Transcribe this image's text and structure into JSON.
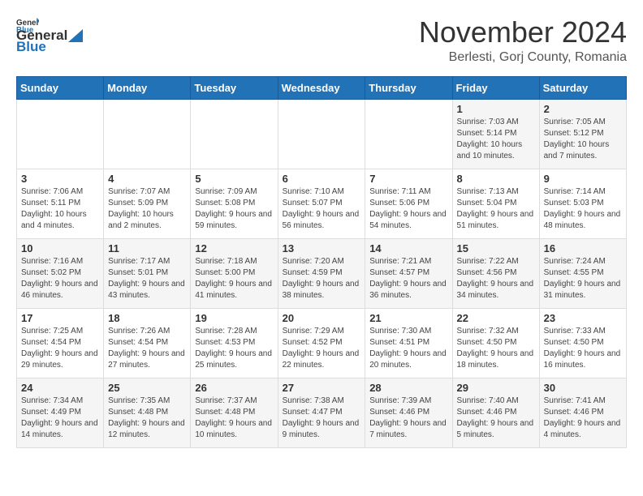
{
  "logo": {
    "general": "General",
    "blue": "Blue"
  },
  "header": {
    "title": "November 2024",
    "subtitle": "Berlesti, Gorj County, Romania"
  },
  "weekdays": [
    "Sunday",
    "Monday",
    "Tuesday",
    "Wednesday",
    "Thursday",
    "Friday",
    "Saturday"
  ],
  "weeks": [
    [
      {
        "day": "",
        "info": ""
      },
      {
        "day": "",
        "info": ""
      },
      {
        "day": "",
        "info": ""
      },
      {
        "day": "",
        "info": ""
      },
      {
        "day": "",
        "info": ""
      },
      {
        "day": "1",
        "info": "Sunrise: 7:03 AM\nSunset: 5:14 PM\nDaylight: 10 hours and 10 minutes."
      },
      {
        "day": "2",
        "info": "Sunrise: 7:05 AM\nSunset: 5:12 PM\nDaylight: 10 hours and 7 minutes."
      }
    ],
    [
      {
        "day": "3",
        "info": "Sunrise: 7:06 AM\nSunset: 5:11 PM\nDaylight: 10 hours and 4 minutes."
      },
      {
        "day": "4",
        "info": "Sunrise: 7:07 AM\nSunset: 5:09 PM\nDaylight: 10 hours and 2 minutes."
      },
      {
        "day": "5",
        "info": "Sunrise: 7:09 AM\nSunset: 5:08 PM\nDaylight: 9 hours and 59 minutes."
      },
      {
        "day": "6",
        "info": "Sunrise: 7:10 AM\nSunset: 5:07 PM\nDaylight: 9 hours and 56 minutes."
      },
      {
        "day": "7",
        "info": "Sunrise: 7:11 AM\nSunset: 5:06 PM\nDaylight: 9 hours and 54 minutes."
      },
      {
        "day": "8",
        "info": "Sunrise: 7:13 AM\nSunset: 5:04 PM\nDaylight: 9 hours and 51 minutes."
      },
      {
        "day": "9",
        "info": "Sunrise: 7:14 AM\nSunset: 5:03 PM\nDaylight: 9 hours and 48 minutes."
      }
    ],
    [
      {
        "day": "10",
        "info": "Sunrise: 7:16 AM\nSunset: 5:02 PM\nDaylight: 9 hours and 46 minutes."
      },
      {
        "day": "11",
        "info": "Sunrise: 7:17 AM\nSunset: 5:01 PM\nDaylight: 9 hours and 43 minutes."
      },
      {
        "day": "12",
        "info": "Sunrise: 7:18 AM\nSunset: 5:00 PM\nDaylight: 9 hours and 41 minutes."
      },
      {
        "day": "13",
        "info": "Sunrise: 7:20 AM\nSunset: 4:59 PM\nDaylight: 9 hours and 38 minutes."
      },
      {
        "day": "14",
        "info": "Sunrise: 7:21 AM\nSunset: 4:57 PM\nDaylight: 9 hours and 36 minutes."
      },
      {
        "day": "15",
        "info": "Sunrise: 7:22 AM\nSunset: 4:56 PM\nDaylight: 9 hours and 34 minutes."
      },
      {
        "day": "16",
        "info": "Sunrise: 7:24 AM\nSunset: 4:55 PM\nDaylight: 9 hours and 31 minutes."
      }
    ],
    [
      {
        "day": "17",
        "info": "Sunrise: 7:25 AM\nSunset: 4:54 PM\nDaylight: 9 hours and 29 minutes."
      },
      {
        "day": "18",
        "info": "Sunrise: 7:26 AM\nSunset: 4:54 PM\nDaylight: 9 hours and 27 minutes."
      },
      {
        "day": "19",
        "info": "Sunrise: 7:28 AM\nSunset: 4:53 PM\nDaylight: 9 hours and 25 minutes."
      },
      {
        "day": "20",
        "info": "Sunrise: 7:29 AM\nSunset: 4:52 PM\nDaylight: 9 hours and 22 minutes."
      },
      {
        "day": "21",
        "info": "Sunrise: 7:30 AM\nSunset: 4:51 PM\nDaylight: 9 hours and 20 minutes."
      },
      {
        "day": "22",
        "info": "Sunrise: 7:32 AM\nSunset: 4:50 PM\nDaylight: 9 hours and 18 minutes."
      },
      {
        "day": "23",
        "info": "Sunrise: 7:33 AM\nSunset: 4:50 PM\nDaylight: 9 hours and 16 minutes."
      }
    ],
    [
      {
        "day": "24",
        "info": "Sunrise: 7:34 AM\nSunset: 4:49 PM\nDaylight: 9 hours and 14 minutes."
      },
      {
        "day": "25",
        "info": "Sunrise: 7:35 AM\nSunset: 4:48 PM\nDaylight: 9 hours and 12 minutes."
      },
      {
        "day": "26",
        "info": "Sunrise: 7:37 AM\nSunset: 4:48 PM\nDaylight: 9 hours and 10 minutes."
      },
      {
        "day": "27",
        "info": "Sunrise: 7:38 AM\nSunset: 4:47 PM\nDaylight: 9 hours and 9 minutes."
      },
      {
        "day": "28",
        "info": "Sunrise: 7:39 AM\nSunset: 4:46 PM\nDaylight: 9 hours and 7 minutes."
      },
      {
        "day": "29",
        "info": "Sunrise: 7:40 AM\nSunset: 4:46 PM\nDaylight: 9 hours and 5 minutes."
      },
      {
        "day": "30",
        "info": "Sunrise: 7:41 AM\nSunset: 4:46 PM\nDaylight: 9 hours and 4 minutes."
      }
    ]
  ]
}
